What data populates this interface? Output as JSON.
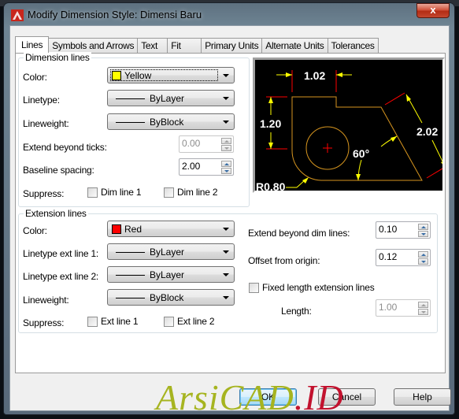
{
  "window": {
    "title": "Modify Dimension Style: Dimensi Baru",
    "close_label": "x"
  },
  "tabs": [
    {
      "label": "Lines",
      "active": true
    },
    {
      "label": "Symbols and Arrows",
      "active": false
    },
    {
      "label": "Text",
      "active": false
    },
    {
      "label": "Fit",
      "active": false
    },
    {
      "label": "Primary Units",
      "active": false
    },
    {
      "label": "Alternate Units",
      "active": false
    },
    {
      "label": "Tolerances",
      "active": false
    }
  ],
  "dimension_lines": {
    "title": "Dimension lines",
    "color_label": "Color:",
    "color_value": "Yellow",
    "color_hex": "#ffff00",
    "linetype_label": "Linetype:",
    "linetype_value": "ByLayer",
    "lineweight_label": "Lineweight:",
    "lineweight_value": "ByBlock",
    "extend_label": "Extend beyond ticks:",
    "extend_value": "0.00",
    "baseline_label": "Baseline spacing:",
    "baseline_value": "2.00",
    "suppress_label": "Suppress:",
    "dim_line1_label": "Dim line 1",
    "dim_line2_label": "Dim line 2"
  },
  "extension_lines": {
    "title": "Extension lines",
    "color_label": "Color:",
    "color_value": "Red",
    "color_hex": "#ff0000",
    "linetype1_label": "Linetype ext line 1:",
    "linetype1_value": "ByLayer",
    "linetype2_label": "Linetype ext line 2:",
    "linetype2_value": "ByLayer",
    "lineweight_label": "Lineweight:",
    "lineweight_value": "ByBlock",
    "suppress_label": "Suppress:",
    "ext_line1_label": "Ext line 1",
    "ext_line2_label": "Ext line 2",
    "extend_beyond_label": "Extend beyond dim lines:",
    "extend_beyond_value": "0.10",
    "offset_label": "Offset from origin:",
    "offset_value": "0.12",
    "fixed_length_label": "Fixed length extension lines",
    "length_label": "Length:",
    "length_value": "1.00"
  },
  "preview": {
    "dim_top": "1.02",
    "dim_left": "1.20",
    "dim_slant": "2.02",
    "dim_angle": "60°",
    "dim_radius": "R0.80"
  },
  "buttons": {
    "ok": "OK",
    "cancel": "Cancel",
    "help": "Help"
  },
  "watermark": {
    "part1": "ArsiCAD",
    "part2": ".ID"
  }
}
